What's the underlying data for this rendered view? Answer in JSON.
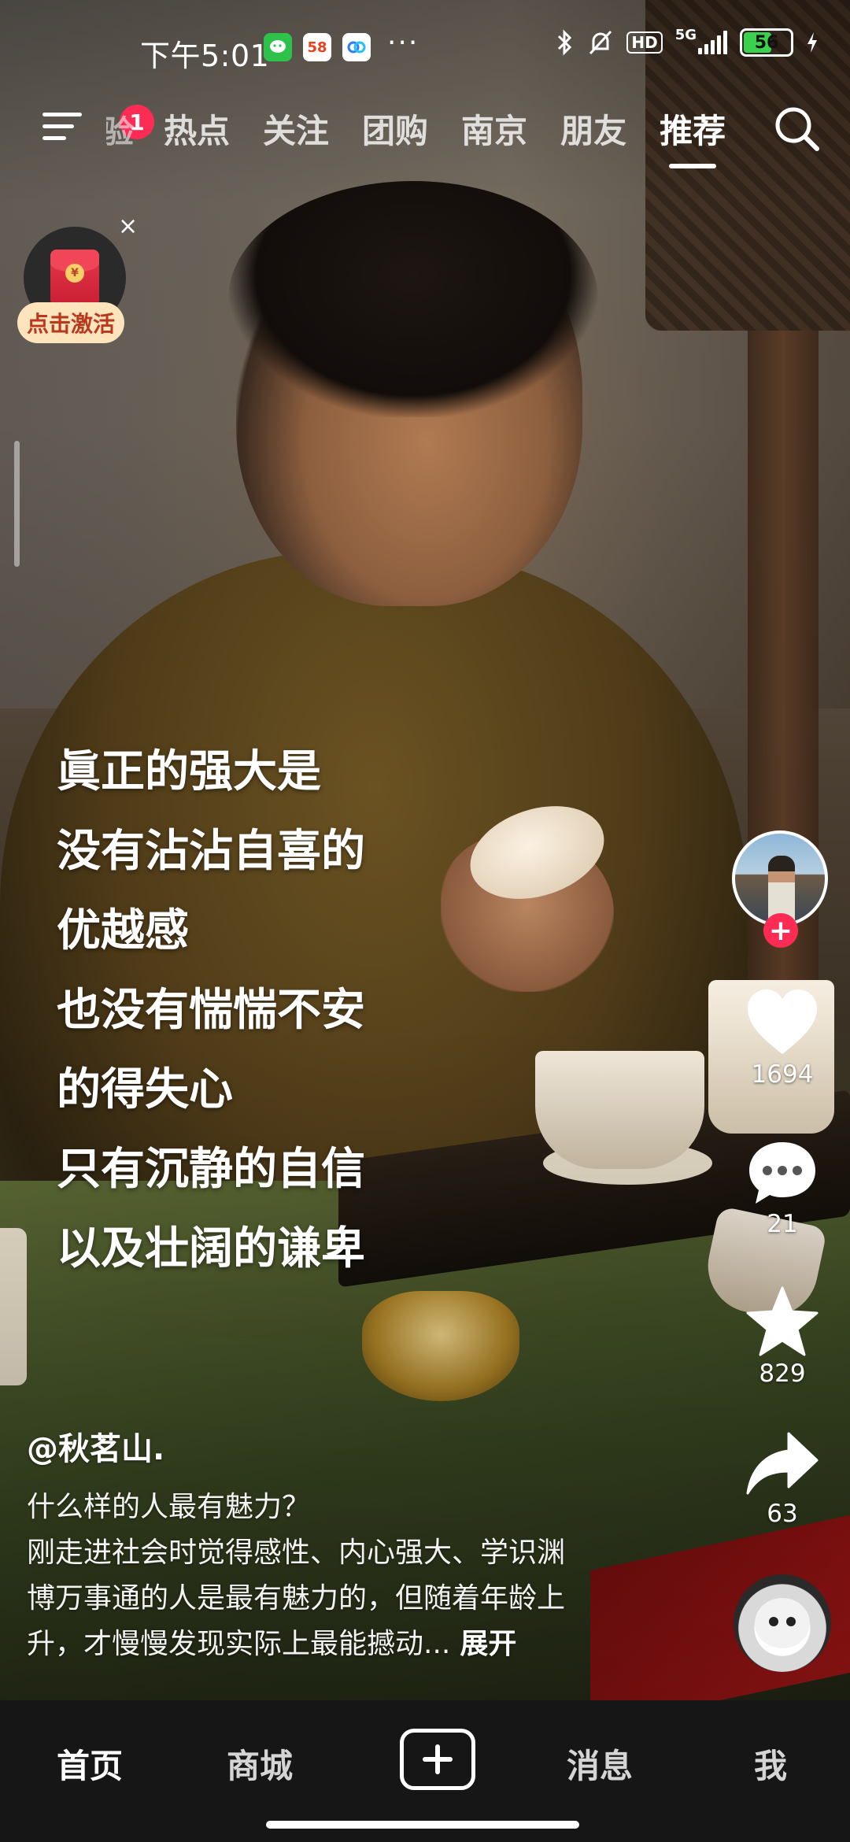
{
  "status_bar": {
    "time": "下午5:01",
    "app_icons": [
      "wechat-icon",
      "58-app-icon",
      "baidu-netdisk-icon"
    ],
    "more": "···",
    "icons": [
      "bluetooth-icon",
      "mute-bell-icon",
      "hd-badge",
      "5g-signal-icon",
      "battery-icon",
      "charging-icon"
    ],
    "hd": "HD",
    "network": "5G",
    "battery_percent": "56"
  },
  "top_nav": {
    "menu_badge": "1",
    "partial_tab": "经验",
    "tabs": [
      "热点",
      "关注",
      "团购",
      "南京",
      "朋友",
      "推荐"
    ],
    "active_tab": "推荐"
  },
  "red_packet": {
    "label": "点击激活",
    "close": "×"
  },
  "overlay_text": [
    "眞正的强大是",
    "没有沾沾自喜的",
    "优越感",
    "也没有惴惴不安",
    "的得失心",
    "只有沉静的自信",
    "以及壮阔的谦卑"
  ],
  "actions": {
    "follow": "+",
    "likes": "1694",
    "comments": "21",
    "favorites": "829",
    "shares": "63"
  },
  "caption": {
    "author": "@秋茗山.",
    "lines": [
      "什么样的人最有魅力？",
      "刚走进社会时觉得感性、内心强大、学识渊",
      "博万事通的人是最有魅力的，但随着年龄上",
      "升，才慢慢发现实际上最能撼动..."
    ],
    "expand": "展开"
  },
  "bottom_nav": {
    "home": "首页",
    "mall": "商城",
    "messages": "消息",
    "me": "我"
  },
  "colors": {
    "accent_red": "#fe2c55",
    "nav_bg": "#161616",
    "packet_label_bg": "#fde4bd"
  }
}
